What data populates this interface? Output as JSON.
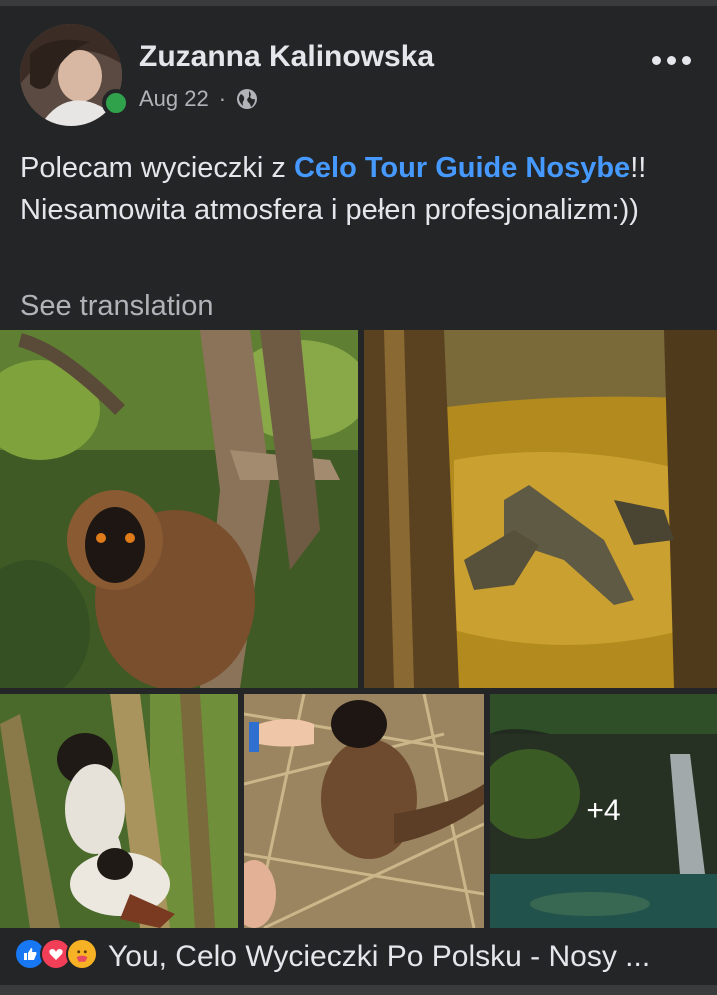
{
  "post": {
    "author": "Zuzanna Kalinowska",
    "date": "Aug 22",
    "separator": "·",
    "text_before": "Polecam wycieczki z ",
    "link_text": "Celo Tour Guide Nosybe",
    "text_after": "!! Niesamowita atmosfera i pełen profesjonalizm:))",
    "see_translation": "See translation"
  },
  "gallery": {
    "more_count": "+4"
  },
  "reactions": {
    "summary": "You, Celo Wycieczki Po Polsku - Nosy ..."
  },
  "icons": [
    "globe-icon",
    "more-options-icon",
    "like-reaction-icon",
    "love-reaction-icon",
    "care-reaction-icon"
  ],
  "colors": {
    "background": "#242526",
    "link": "#4599ff",
    "online": "#31a24c",
    "like": "#1877f2",
    "love": "#f33e58",
    "care": "#f7b125"
  }
}
